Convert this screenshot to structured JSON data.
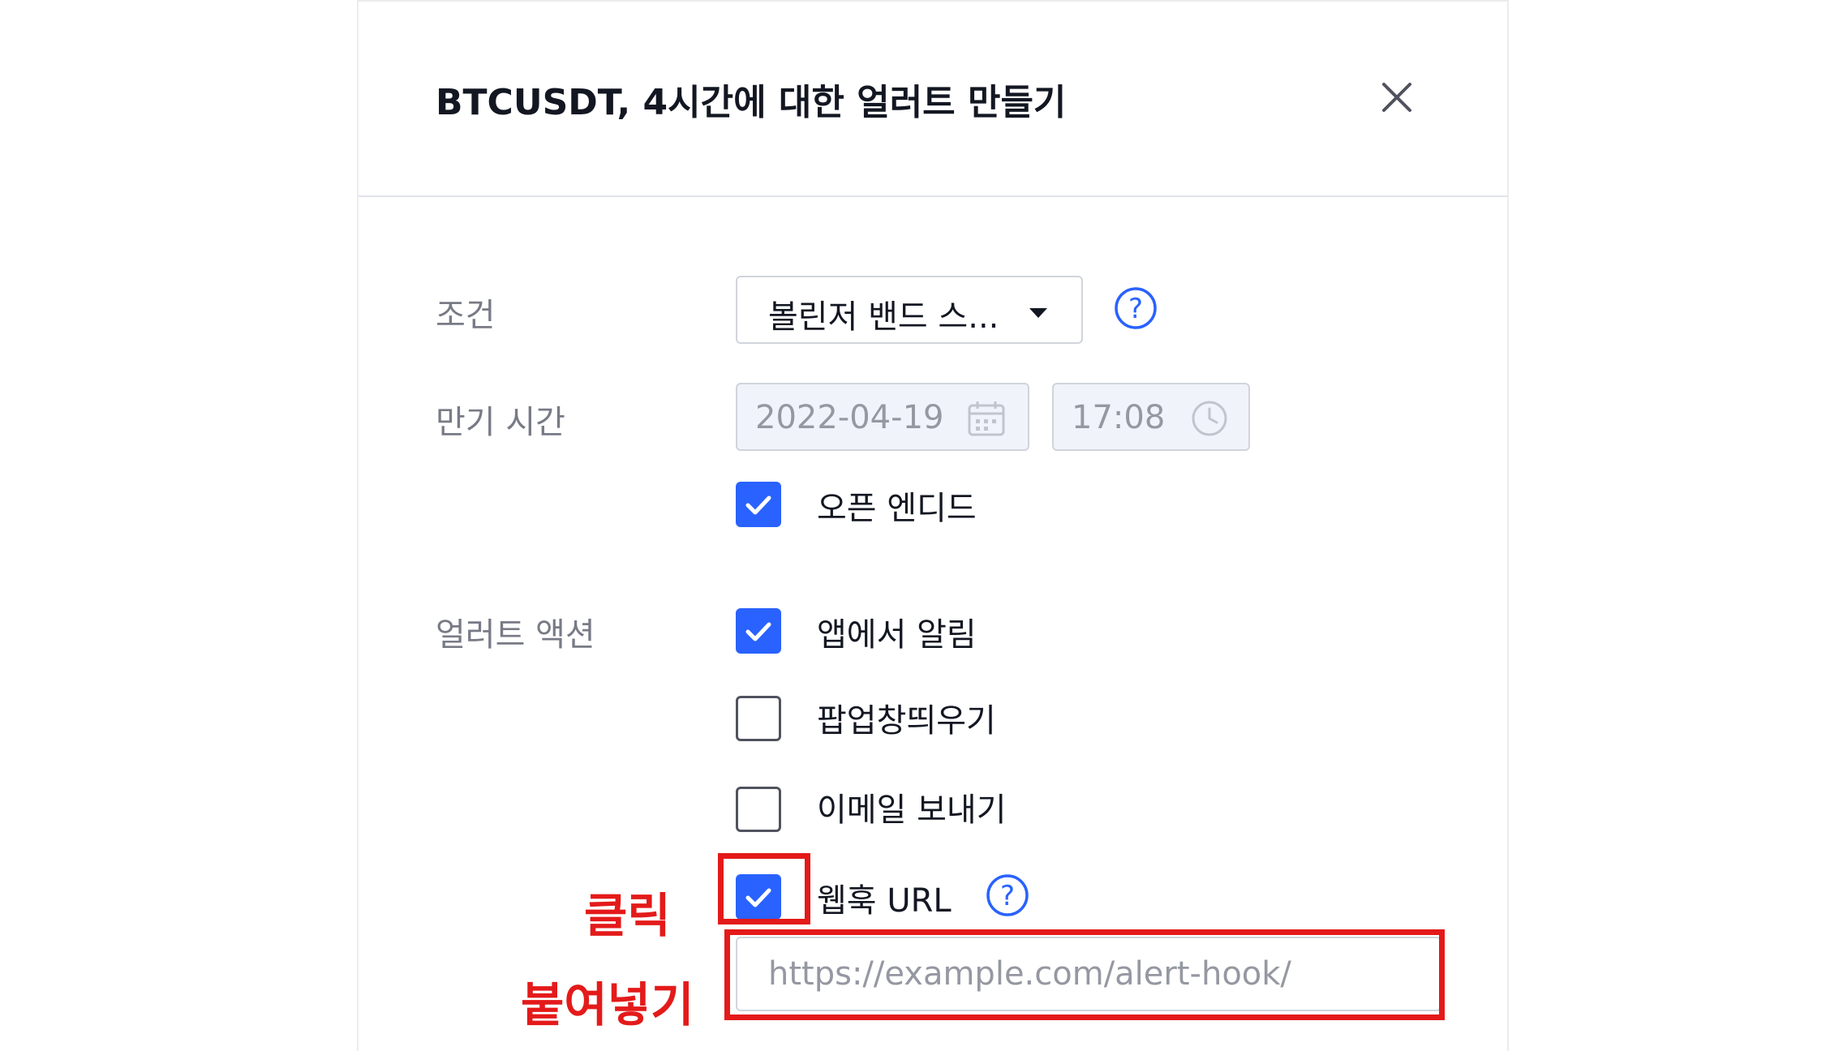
{
  "dialog": {
    "title": "BTCUSDT, 4시간에 대한 얼러트 만들기",
    "close_icon": "close-icon"
  },
  "condition": {
    "label": "조건",
    "selected": "볼린저 밴드 스...",
    "help_icon": "question-circle-icon"
  },
  "expiration": {
    "label": "만기 시간",
    "date": "2022-04-19",
    "time": "17:08",
    "date_icon": "calendar-icon",
    "time_icon": "clock-icon",
    "open_ended": {
      "label": "오픈 엔디드",
      "checked": true
    }
  },
  "actions": {
    "label": "얼러트 액션",
    "items": [
      {
        "label": "앱에서 알림",
        "checked": true
      },
      {
        "label": "팝업창띄우기",
        "checked": false
      },
      {
        "label": "이메일 보내기",
        "checked": false
      },
      {
        "label": "웹훅 URL",
        "checked": true
      }
    ],
    "webhook_help_icon": "question-circle-icon",
    "webhook_url_placeholder": "https://example.com/alert-hook/"
  },
  "annotations": {
    "click": "클릭",
    "paste": "붙여넣기",
    "color": "#e41a1a"
  },
  "colors": {
    "accent": "#2962ff",
    "text": "#131722",
    "muted": "#787b86"
  }
}
